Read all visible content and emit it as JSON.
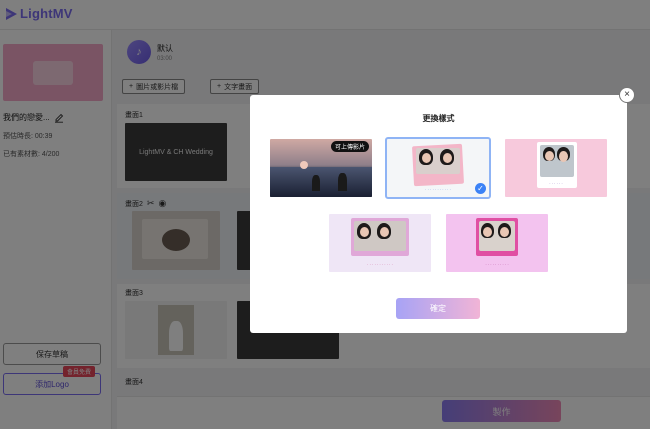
{
  "app": {
    "name": "LightMV"
  },
  "project": {
    "title": "我們的戀愛...",
    "duration_label": "預估時長: 00:39",
    "material_count_label": "已有素材數: 4/200"
  },
  "sidebar": {
    "save_label": "保存草稿",
    "logo_label": "添加Logo",
    "member_badge": "會員免費"
  },
  "music": {
    "name": "默认",
    "time": "03:00",
    "icon": "music-note-icon"
  },
  "toolbar": {
    "add_media_label": "圖片或影片檔",
    "add_text_label": "文字畫面"
  },
  "scenes": [
    {
      "label": "畫面1",
      "slide_text": "LightMV & CH Wedding"
    },
    {
      "label": "畫面2"
    },
    {
      "label": "畫面3"
    },
    {
      "label": "畫面4"
    }
  ],
  "make_label": "製作",
  "modal": {
    "title": "更換樣式",
    "video_badge": "可上傳影片",
    "confirm_label": "確定",
    "selected_index": 1
  },
  "colors": {
    "accent": "#7b6cf0",
    "pink": "#f4a8c8",
    "selected_outline": "#8fb4f5",
    "check": "#3b82f6"
  }
}
